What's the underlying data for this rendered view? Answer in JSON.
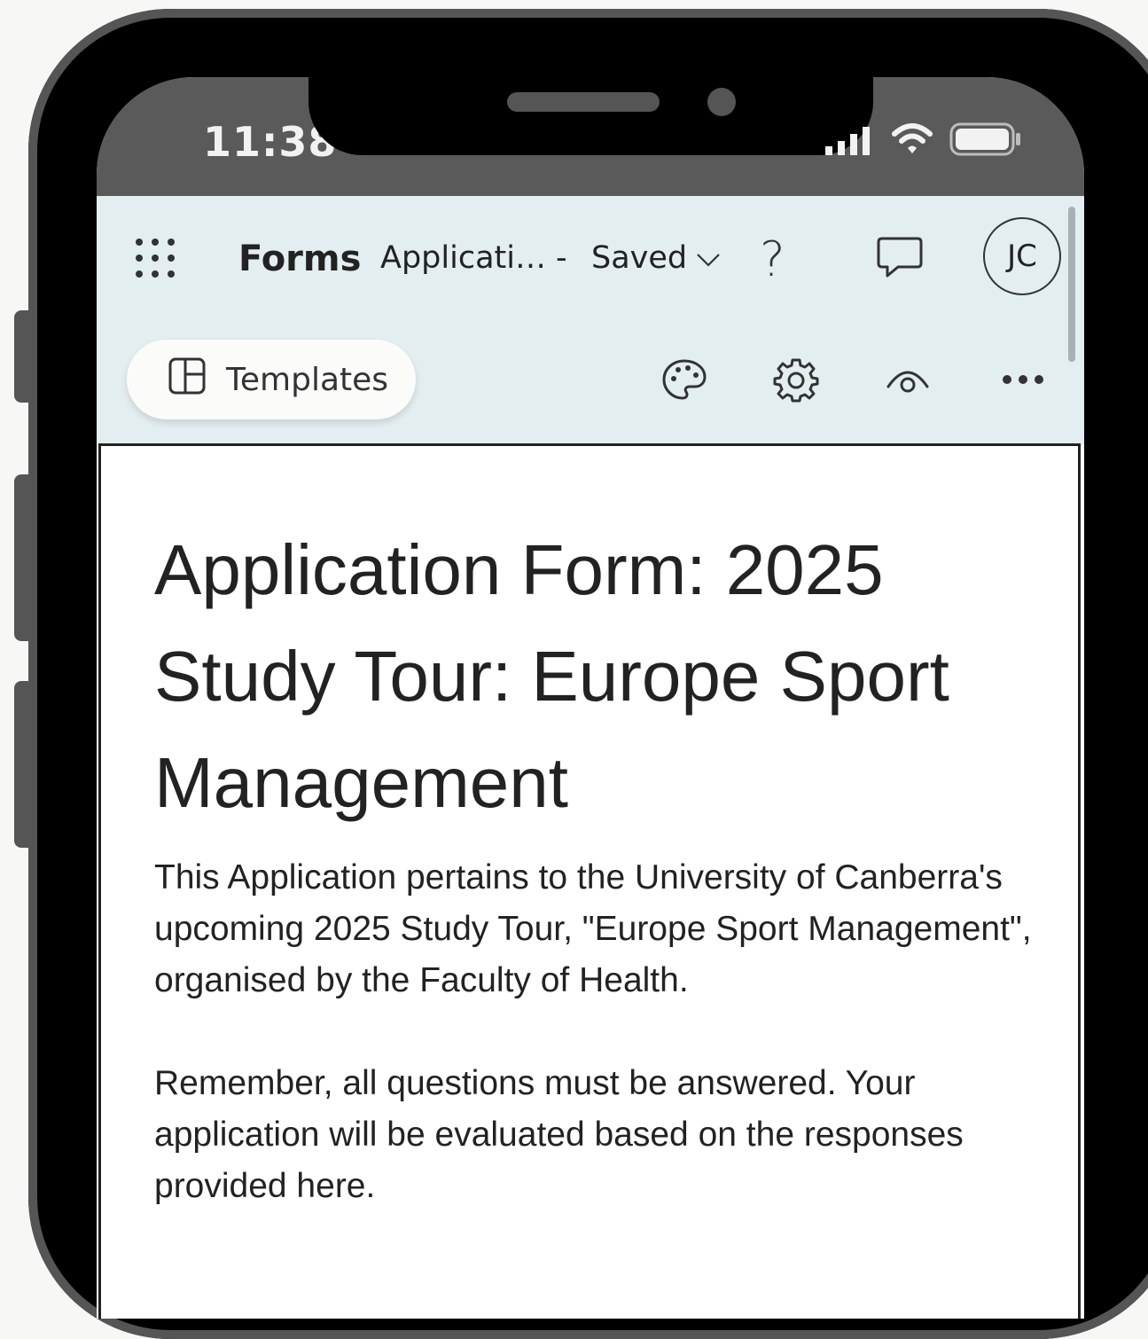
{
  "status_bar": {
    "time": "11:38"
  },
  "header": {
    "app_name": "Forms",
    "doc_title": "Applicati…",
    "separator": "-",
    "save_status": "Saved",
    "help_label": "?",
    "avatar_initials": "JC"
  },
  "toolbar": {
    "templates_label": "Templates",
    "icons": [
      "palette-icon",
      "gear-icon",
      "eye-icon",
      "more-icon"
    ]
  },
  "form": {
    "title": "Application Form: 2025 Study Tour: Europe Sport Management",
    "description_paragraphs": [
      "This Application pertains to the University of Canberra's upcoming 2025 Study Tour, \"Europe Sport Management\", organised by the Faculty of Health.",
      "Remember, all questions must be answered. Your application will be evaluated based on the responses provided here."
    ]
  },
  "colors": {
    "header_bg": "#e3eef1",
    "status_bar_bg": "#5a5a5a",
    "phone_frame": "#000000"
  }
}
